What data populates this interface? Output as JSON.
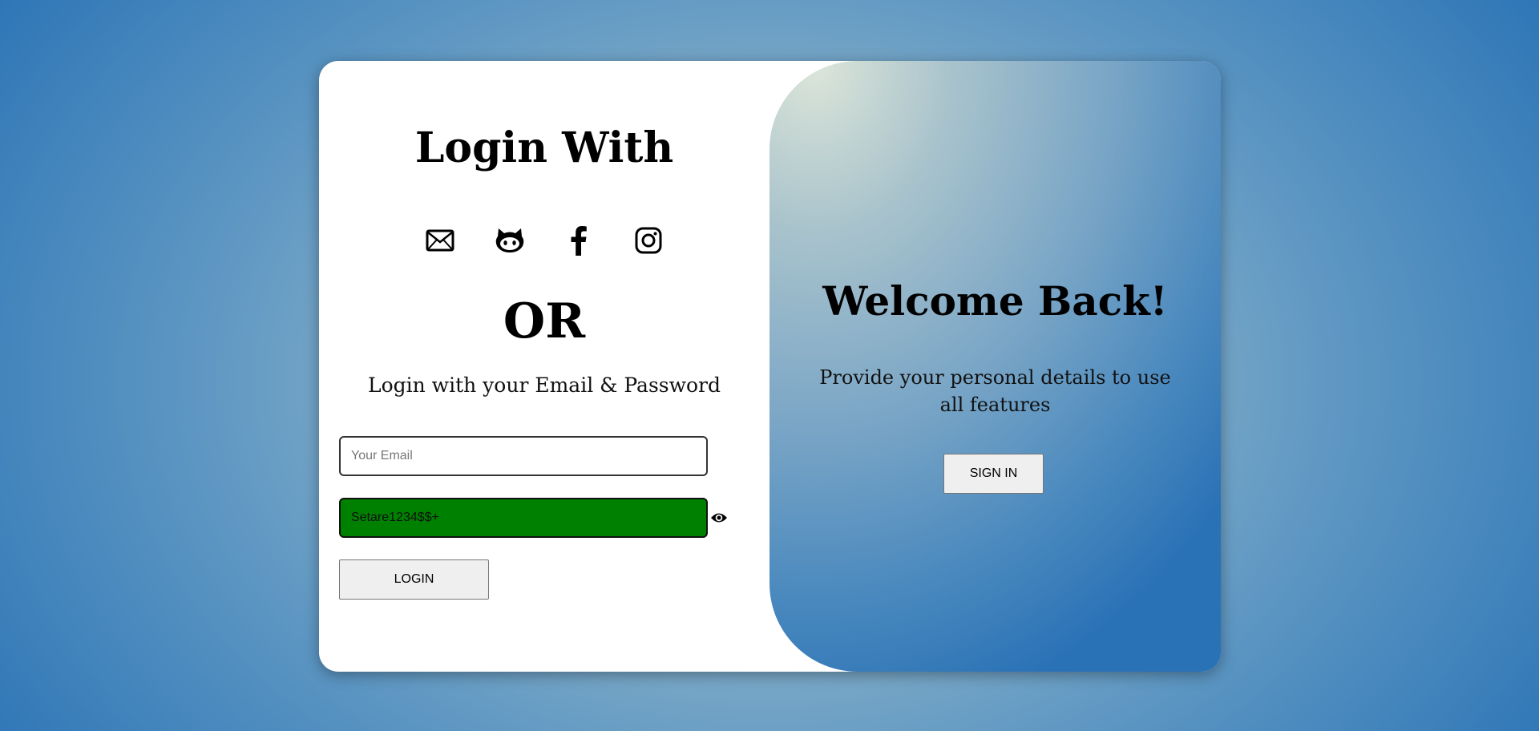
{
  "login": {
    "title": "Login With",
    "social_icons": [
      "mail-icon",
      "github-icon",
      "facebook-icon",
      "instagram-icon"
    ],
    "or_text": "OR",
    "subtitle": "Login with your Email & Password",
    "email_placeholder": "Your Email",
    "email_value": "",
    "password_value": "Setare1234$$+",
    "password_field_color": "#008000",
    "login_label": "LOGIN"
  },
  "welcome": {
    "title": "Welcome Back!",
    "text": "Provide your personal details to use all features",
    "signin_label": "SIGN IN"
  },
  "colors": {
    "background_edge": "#2b74b6",
    "background_center": "#b1ccd7",
    "card": "#ffffff"
  }
}
